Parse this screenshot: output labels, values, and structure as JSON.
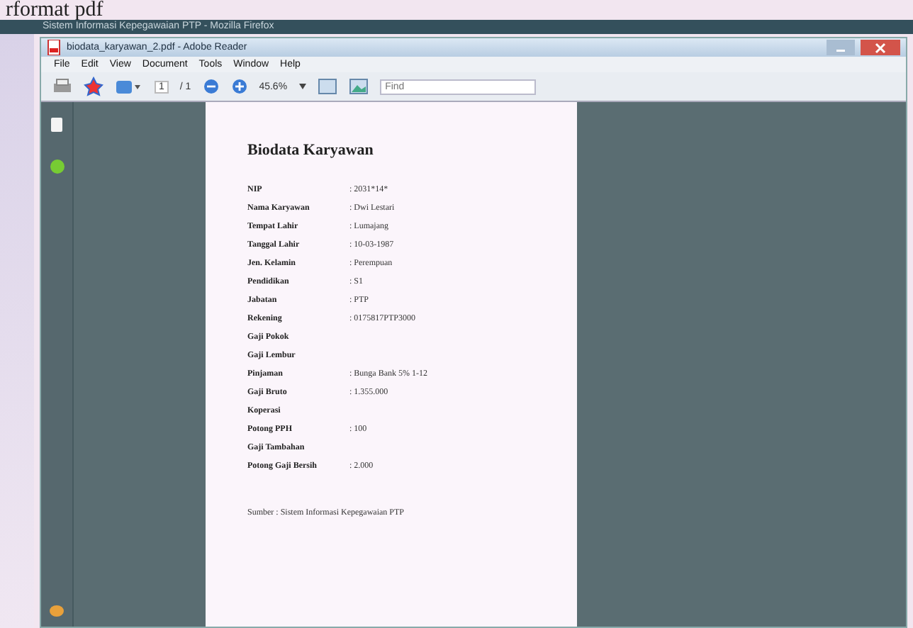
{
  "book_text": "rformat pdf",
  "browser": {
    "title": "Sistem Informasi Kepegawaian PTP - Mozilla Firefox"
  },
  "window": {
    "title": "biodata_karyawan_2.pdf - Adobe Reader"
  },
  "menu": [
    "File",
    "Edit",
    "View",
    "Document",
    "Tools",
    "Window",
    "Help"
  ],
  "toolbar": {
    "page": "1",
    "page_total": "/ 1",
    "zoom": "45.6%",
    "find_placeholder": "Find"
  },
  "document": {
    "title": "Biodata Karyawan",
    "fields": [
      {
        "label": "NIP",
        "value": ": 2031*14*"
      },
      {
        "label": "Nama Karyawan",
        "value": ": Dwi Lestari"
      },
      {
        "label": "Tempat Lahir",
        "value": ": Lumajang"
      },
      {
        "label": "Tanggal Lahir",
        "value": ": 10-03-1987"
      },
      {
        "label": "Jen. Kelamin",
        "value": ": Perempuan"
      },
      {
        "label": "Pendidikan",
        "value": ": S1"
      },
      {
        "label": "Jabatan",
        "value": ": PTP"
      },
      {
        "label": "Rekening",
        "value": ": 0175817PTP3000"
      },
      {
        "label": "Gaji Pokok"
      },
      {
        "label": "Gaji Lembur"
      },
      {
        "label": "Pinjaman",
        "value": ": Bunga Bank 5% 1-12"
      },
      {
        "label": "Gaji Bruto",
        "value": ": 1.355.000"
      },
      {
        "label": "Koperasi"
      },
      {
        "label": "Potong PPH",
        "value": ": 100"
      },
      {
        "label": "Gaji Tambahan"
      },
      {
        "label": "Potong Gaji Bersih",
        "value": ": 2.000"
      }
    ],
    "footer": "Sumber : Sistem Informasi Kepegawaian PTP"
  }
}
